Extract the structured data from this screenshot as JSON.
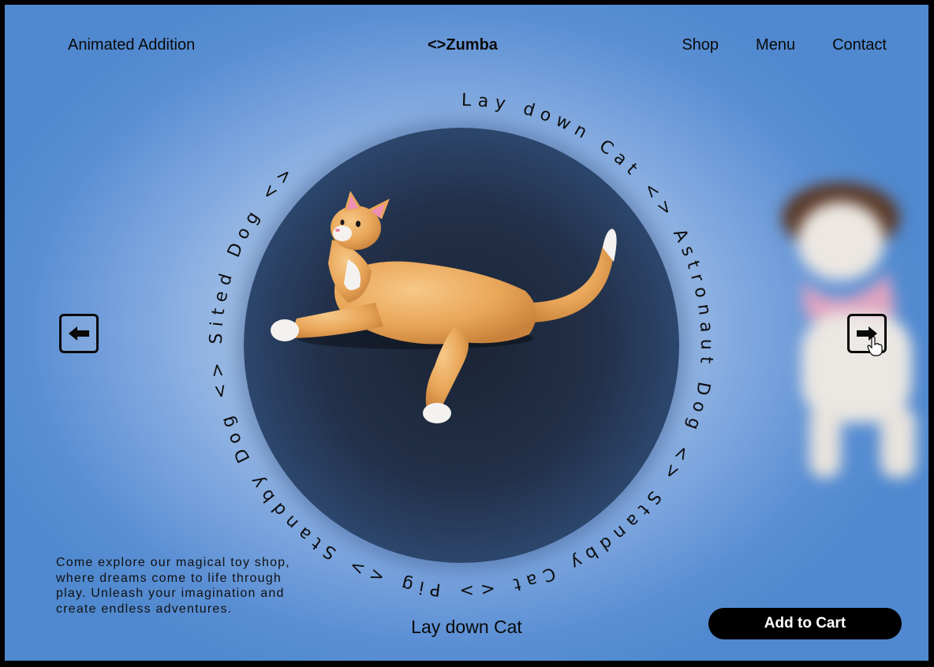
{
  "header": {
    "left_label": "Animated Addition",
    "brand": "<>Zumba",
    "nav": [
      {
        "label": "Shop"
      },
      {
        "label": "Menu"
      },
      {
        "label": "Contact"
      }
    ]
  },
  "carousel": {
    "ring_text": "Lay down Cat <> Astronaut Dog <> Standby Cat <> Pig <> Standby Dog <> Sited Dog <> ",
    "current_item": "Lay down Cat"
  },
  "controls": {
    "prev_icon": "arrow-left-icon",
    "next_icon": "arrow-right-icon"
  },
  "description": "Come explore our magical toy shop, where dreams come to life through play. Unleash your imagination and create endless adventures.",
  "cart": {
    "label": "Add to Cart"
  },
  "colors": {
    "background": "#5b8fd4",
    "circle": "#1b2434",
    "text": "#0a0a0a",
    "button_bg": "#000000",
    "button_text": "#ffffff"
  }
}
